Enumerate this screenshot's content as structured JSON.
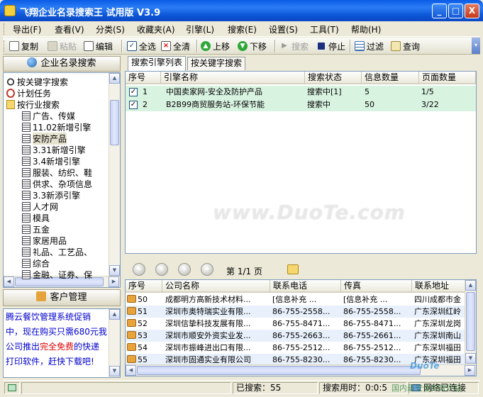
{
  "window": {
    "title": "飞翔企业名录搜索王 试用版 V3.9",
    "min_label": "_",
    "max_label": "□",
    "close_label": "X"
  },
  "menu": [
    "导出(F)",
    "查看(V)",
    "分类(S)",
    "收藏夹(A)",
    "引擎(L)",
    "搜索(E)",
    "设置(S)",
    "工具(T)",
    "帮助(H)"
  ],
  "toolbar": {
    "copy": "复制",
    "paste": "粘贴",
    "edit": "编辑",
    "select_all": "全选",
    "clear_all": "全清",
    "move_up": "上移",
    "move_down": "下移",
    "search": "搜索",
    "stop": "停止",
    "filter": "过滤",
    "query": "查询"
  },
  "sidebar": {
    "header": "企业名录搜索",
    "tree": [
      {
        "label": "按关键字搜索",
        "level": 1,
        "icon": "search-icon"
      },
      {
        "label": "计划任务",
        "level": 1,
        "icon": "clock-icon"
      },
      {
        "label": "按行业搜索",
        "level": 1,
        "icon": "folder-icon"
      },
      {
        "label": "广告、传媒",
        "level": 2
      },
      {
        "label": "11.02新增引擎",
        "level": 2
      },
      {
        "label": "安防产品",
        "level": 2,
        "selected": true
      },
      {
        "label": "3.31新增引擎",
        "level": 2
      },
      {
        "label": "3.4新增引擎",
        "level": 2
      },
      {
        "label": "服装、纺织、鞋",
        "level": 2
      },
      {
        "label": "供求、杂项信息",
        "level": 2
      },
      {
        "label": "3.3新添引擎",
        "level": 2
      },
      {
        "label": "人才网",
        "level": 2
      },
      {
        "label": "模具",
        "level": 2
      },
      {
        "label": "五金",
        "level": 2
      },
      {
        "label": "家居用品",
        "level": 2
      },
      {
        "label": "礼品、工艺品、",
        "level": 2
      },
      {
        "label": "综合",
        "level": 2
      },
      {
        "label": "金融、证券、保",
        "level": 2
      }
    ],
    "customer_header": "客户管理",
    "ad_parts": [
      {
        "text": "腾云餐饮管理系统促销中，现在购买只需680元我公司推出",
        "red": false
      },
      {
        "text": "完全免费",
        "red": true
      },
      {
        "text": "的快递打印软件，赶快下载吧!",
        "red": false
      }
    ]
  },
  "tabs": [
    "搜索引擎列表",
    "按关键字搜索"
  ],
  "engine_table": {
    "columns": [
      "序号",
      "引擎名称",
      "搜索状态",
      "信息数量",
      "页面数量"
    ],
    "rows": [
      {
        "checked": true,
        "no": "1",
        "name": "中国卖家网-安全及防护产品",
        "status": "搜索中[1]",
        "count": "5",
        "pages": "1/5"
      },
      {
        "checked": true,
        "no": "2",
        "name": "B2B99商贸服务站-环保节能",
        "status": "搜索中",
        "count": "50",
        "pages": "3/22"
      }
    ]
  },
  "pager": {
    "text": "第 1/1 页"
  },
  "result_table": {
    "columns": [
      "序号",
      "公司名称",
      "联系电话",
      "传真",
      "联系地址"
    ],
    "rows": [
      {
        "no": "50",
        "company": "成都明方高新技术材料...",
        "phone": "[信息补充 ...",
        "fax": "[信息补充 ...",
        "address": "四川成都市金"
      },
      {
        "no": "51",
        "company": "深圳市奥特瑞实业有限...",
        "phone": "86-755-2558...",
        "fax": "86-755-2558...",
        "address": "广东深圳红岭"
      },
      {
        "no": "52",
        "company": "深圳信挚科技发展有限...",
        "phone": "86-755-8471...",
        "fax": "86-755-8471...",
        "address": "广东深圳龙岗"
      },
      {
        "no": "53",
        "company": "深圳市顺安外资实业发...",
        "phone": "86-755-2663...",
        "fax": "86-755-2661...",
        "address": "广东深圳南山"
      },
      {
        "no": "54",
        "company": "深圳市振峰进出口有限...",
        "phone": "86-755-2512...",
        "fax": "86-755-2512...",
        "address": "广东深圳福田"
      },
      {
        "no": "55",
        "company": "深圳市固通实业有限公司",
        "phone": "86-755-8230...",
        "fax": "86-755-8230...",
        "address": "广东深圳福田"
      }
    ]
  },
  "status": {
    "searched": "已搜索：55",
    "elapsed": "搜索用时：0:0:5",
    "network": "网络已连接"
  },
  "watermark": "www.DuoTe.com",
  "corner_watermark": {
    "brand": "DuoTe",
    "caption": "国内最安全的软件站"
  }
}
